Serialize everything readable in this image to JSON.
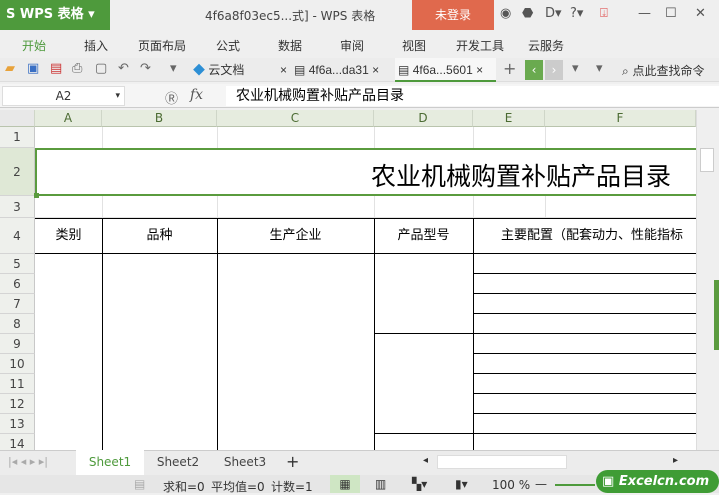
{
  "app": {
    "logo": "S WPS 表格",
    "title": "4f6a8f03ec5...式] - WPS 表格",
    "login": "未登录"
  },
  "menu": [
    "开始",
    "插入",
    "页面布局",
    "公式",
    "数据",
    "审阅",
    "视图",
    "开发工具",
    "云服务"
  ],
  "tabs": [
    {
      "label": "云文档"
    },
    {
      "label": "4f6a...da31"
    },
    {
      "label": "4f6a...5601"
    }
  ],
  "search": "点此查找命令",
  "formula": {
    "cell": "A2",
    "fx": "fx",
    "value": "农业机械购置补贴产品目录"
  },
  "columns": [
    "A",
    "B",
    "C",
    "D",
    "E",
    "F"
  ],
  "rows": [
    "1",
    "2",
    "3",
    "4",
    "5",
    "6",
    "7",
    "8",
    "9",
    "10",
    "11",
    "12",
    "13",
    "14"
  ],
  "sheet": {
    "title": "农业机械购置补贴产品目录",
    "headers": [
      "类别",
      "品种",
      "生产企业",
      "产品型号",
      "主要配置（配套动力、性能指标"
    ]
  },
  "sheets": [
    "Sheet1",
    "Sheet2",
    "Sheet3"
  ],
  "status": {
    "sum": "求和=0",
    "avg": "平均值=0",
    "count": "计数=1",
    "zoom": "100 %"
  },
  "watermark": "Excelcn.com",
  "colors": {
    "accent": "#4e9a3c",
    "login": "#e0694d"
  }
}
